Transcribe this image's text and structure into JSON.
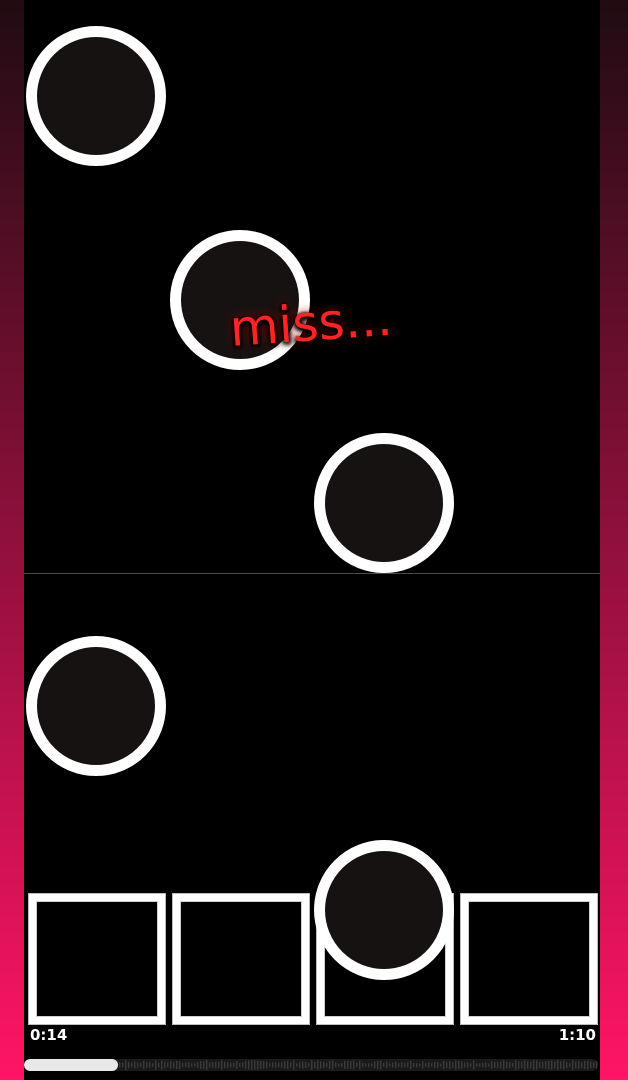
{
  "game": {
    "judgement_text": "miss...",
    "time_elapsed": "0:14",
    "time_total": "1:10",
    "progress_fraction": 0.164,
    "lanes": 4,
    "notes": [
      {
        "lane": 1
      },
      {
        "lane": 2
      },
      {
        "lane": 3
      },
      {
        "lane": 1
      },
      {
        "lane": 3
      }
    ]
  },
  "colors": {
    "background": "#000000",
    "note_fill": "#171212",
    "note_ring": "#ffffff",
    "miss_text": "#ff2424",
    "side_gradient_top": "#200c12",
    "side_gradient_bottom": "#ff1466",
    "progress_fill": "#e8e8e8"
  }
}
